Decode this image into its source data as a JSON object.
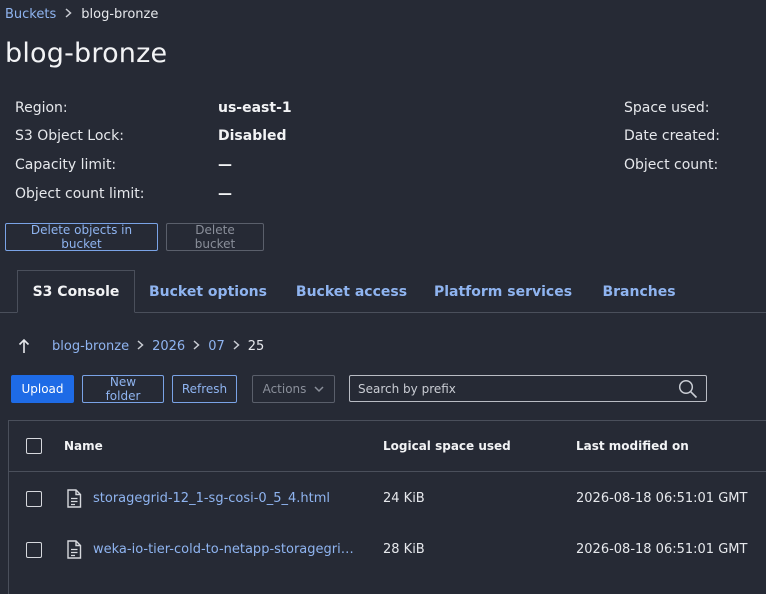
{
  "breadcrumb": {
    "root": "Buckets",
    "current": "blog-bronze"
  },
  "title": "blog-bronze",
  "details": {
    "region_label": "Region:",
    "region_value": "us-east-1",
    "lock_label": "S3 Object Lock:",
    "lock_value": "Disabled",
    "capacity_label": "Capacity limit:",
    "capacity_value": "—",
    "count_limit_label": "Object count limit:",
    "count_limit_value": "—",
    "space_used_label": "Space used:",
    "date_created_label": "Date created:",
    "object_count_label": "Object count:"
  },
  "actions": {
    "delete_objects": "Delete objects in bucket",
    "delete_bucket": "Delete bucket"
  },
  "tabs": [
    "S3 Console",
    "Bucket options",
    "Bucket access",
    "Platform services",
    "Branches"
  ],
  "path": {
    "up_icon": "↑",
    "segments": [
      "blog-bronze",
      "2026",
      "07"
    ],
    "current": "25"
  },
  "toolbar": {
    "upload": "Upload",
    "new_folder": "New folder",
    "refresh": "Refresh",
    "actions": "Actions",
    "search_placeholder": "Search by prefix"
  },
  "table": {
    "headers": {
      "name": "Name",
      "size": "Logical space used",
      "modified": "Last modified on"
    },
    "rows": [
      {
        "name": "storagegrid-12_1-sg-cosi-0_5_4.html",
        "size": "24 KiB",
        "modified": "2026-08-18 06:51:01 GMT"
      },
      {
        "name": "weka-io-tier-cold-to-netapp-storagegri…",
        "size": "28 KiB",
        "modified": "2026-08-18 06:51:01 GMT"
      }
    ]
  },
  "colors": {
    "background": "#262a35",
    "link": "#8fb4f0",
    "primary": "#1e6be6"
  }
}
